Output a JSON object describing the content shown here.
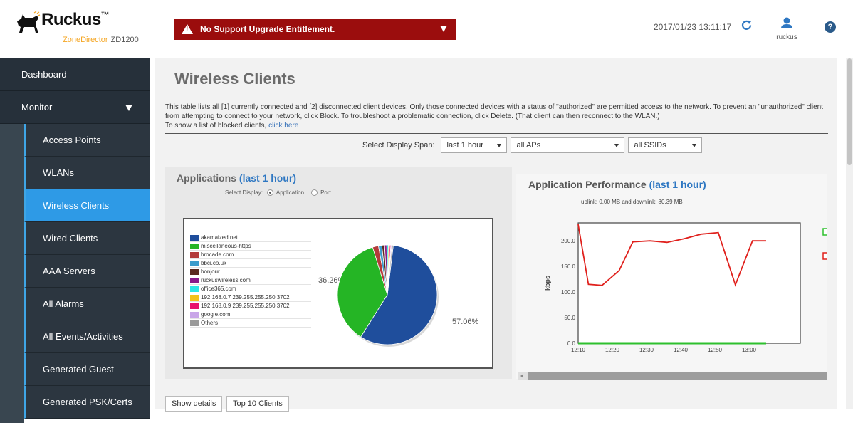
{
  "header": {
    "brand": "Ruckus",
    "brand_tm": "™",
    "product": "ZoneDirector",
    "model": "ZD1200",
    "alert": "No Support Upgrade Entitlement.",
    "datetime": "2017/01/23  13:11:17",
    "username": "ruckus",
    "help_label": "?"
  },
  "sidebar": {
    "top_items": [
      {
        "label": "Dashboard"
      },
      {
        "label": "Monitor"
      }
    ],
    "sub_items": [
      {
        "label": "Access Points"
      },
      {
        "label": "WLANs"
      },
      {
        "label": "Wireless Clients",
        "active": true
      },
      {
        "label": "Wired Clients"
      },
      {
        "label": "AAA Servers"
      },
      {
        "label": "All Alarms"
      },
      {
        "label": "All Events/Activities"
      },
      {
        "label": "Generated Guest"
      },
      {
        "label": "Generated PSK/Certs"
      }
    ]
  },
  "main": {
    "title": "Wireless Clients",
    "description_1": "This table lists all [1] currently connected and [2] disconnected client devices. Only those connected devices with a status of \"authorized\" are permitted access to the network. To prevent an \"unauthorized\" client from attempting to connect to your network, click Block. To troubleshoot a problematic connection, click Delete. (That client can then reconnect to the WLAN.)",
    "description_2": "To show a list of blocked clients, ",
    "blocked_link": "click here",
    "filters": {
      "span_label": "Select Display Span:",
      "span_value": "last 1 hour",
      "ap_value": "all APs",
      "ssid_value": "all SSIDs"
    },
    "buttons": {
      "show_details": "Show details",
      "top10": "Top 10 Clients"
    }
  },
  "applications": {
    "title": "Applications",
    "title_span": "(last 1 hour)",
    "select_display_label": "Select Display:",
    "option_application": "Application",
    "option_port": "Port",
    "label_large": "57.06%",
    "label_second": "36.26%"
  },
  "performance": {
    "title": "Application Performance",
    "title_span": "(last 1 hour)",
    "summary": "uplink: 0.00 MB and downlink: 80.39 MB",
    "ylabel": "kbps"
  },
  "colors": {
    "alert_bg": "#9b0d0d",
    "accent": "#2e9ae6",
    "downlink": "#e0201c",
    "uplink": "#2ec02e"
  },
  "chart_data": [
    {
      "type": "pie",
      "title": "Applications (last 1 hour)",
      "categories": [
        "akamaized.net",
        "miscellaneous-https",
        "brocade.com",
        "bbci.co.uk",
        "bonjour",
        "ruckuswireless.com",
        "office365.com",
        "192.168.0.7 239.255.255.250:3702",
        "192.168.0.9 239.255.255.250:3702",
        "google.com",
        "Others"
      ],
      "values": [
        57.06,
        36.26,
        1.9,
        1.1,
        0.9,
        0.7,
        0.5,
        0.4,
        0.4,
        0.3,
        0.48
      ],
      "colors": [
        "#1f4e9c",
        "#25b525",
        "#b33b3b",
        "#3b9ccc",
        "#5a2a1f",
        "#8a1a8a",
        "#2ee6e6",
        "#f2c21b",
        "#e8126b",
        "#c9a6e8",
        "#9a9a9a"
      ],
      "legend": "left"
    },
    {
      "type": "line",
      "title": "Application Performance (last 1 hour)",
      "ylabel": "kbps",
      "xlabel": "",
      "x": [
        "12:10",
        "12:13",
        "12:17",
        "12:22",
        "12:26",
        "12:31",
        "12:36",
        "12:41",
        "12:46",
        "12:51",
        "12:56",
        "13:01",
        "13:05"
      ],
      "xticks": [
        "12:10",
        "12:20",
        "12:30",
        "12:40",
        "12:50",
        "13:00"
      ],
      "yticks": [
        "0.0",
        "50.0",
        "100.0",
        "150.0",
        "200.0"
      ],
      "ylim": [
        0,
        235
      ],
      "series": [
        {
          "values": [
            232,
            115,
            113,
            142,
            198,
            200,
            197,
            204,
            213,
            216,
            114,
            200,
            200
          ]
        },
        {
          "values": [
            0,
            0,
            0,
            0,
            0,
            0,
            0,
            0,
            0,
            0,
            0,
            0,
            0
          ]
        }
      ],
      "grid": false
    }
  ]
}
